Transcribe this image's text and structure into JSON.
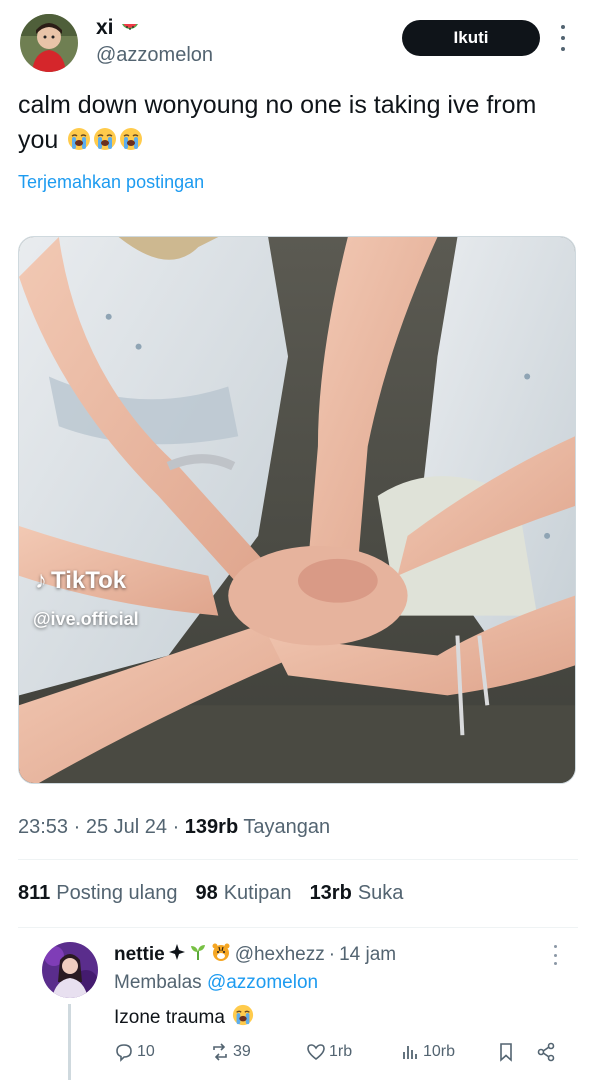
{
  "author": {
    "display_name": "xi",
    "name_emoji": "watermelon-icon",
    "handle": "@azzomelon",
    "follow_label": "Ikuti"
  },
  "tweet": {
    "text": "calm down wonyoung no one is taking ive from you",
    "trailing_emoji": [
      "loudly-crying-face-icon",
      "loudly-crying-face-icon",
      "loudly-crying-face-icon"
    ],
    "translate_label": "Terjemahkan postingan",
    "media": {
      "watermark_brand": "TikTok",
      "watermark_handle": "@ive.official"
    },
    "time": "23:53",
    "date": "25 Jul 24",
    "views_count": "139rb",
    "views_label": "Tayangan"
  },
  "stats": {
    "reposts_count": "811",
    "reposts_label": "Posting ulang",
    "quotes_count": "98",
    "quotes_label": "Kutipan",
    "likes_count": "13rb",
    "likes_label": "Suka"
  },
  "reply": {
    "display_name": "nettie",
    "name_emoji": [
      "sparkle-star-icon",
      "seedling-icon",
      "tiger-face-icon"
    ],
    "handle": "@hexhezz",
    "time": "14 jam",
    "replying_prefix": "Membalas",
    "replying_to": "@azzomelon",
    "text": "Izone trauma",
    "text_emoji": "loudly-crying-face-icon",
    "replies": "10",
    "reposts": "39",
    "likes": "1rb",
    "views": "10rb"
  },
  "colors": {
    "text": "#0f1419",
    "secondary": "#536471",
    "link": "#1d9bf0",
    "button_bg": "#0f1419",
    "divider": "#eff3f4"
  }
}
